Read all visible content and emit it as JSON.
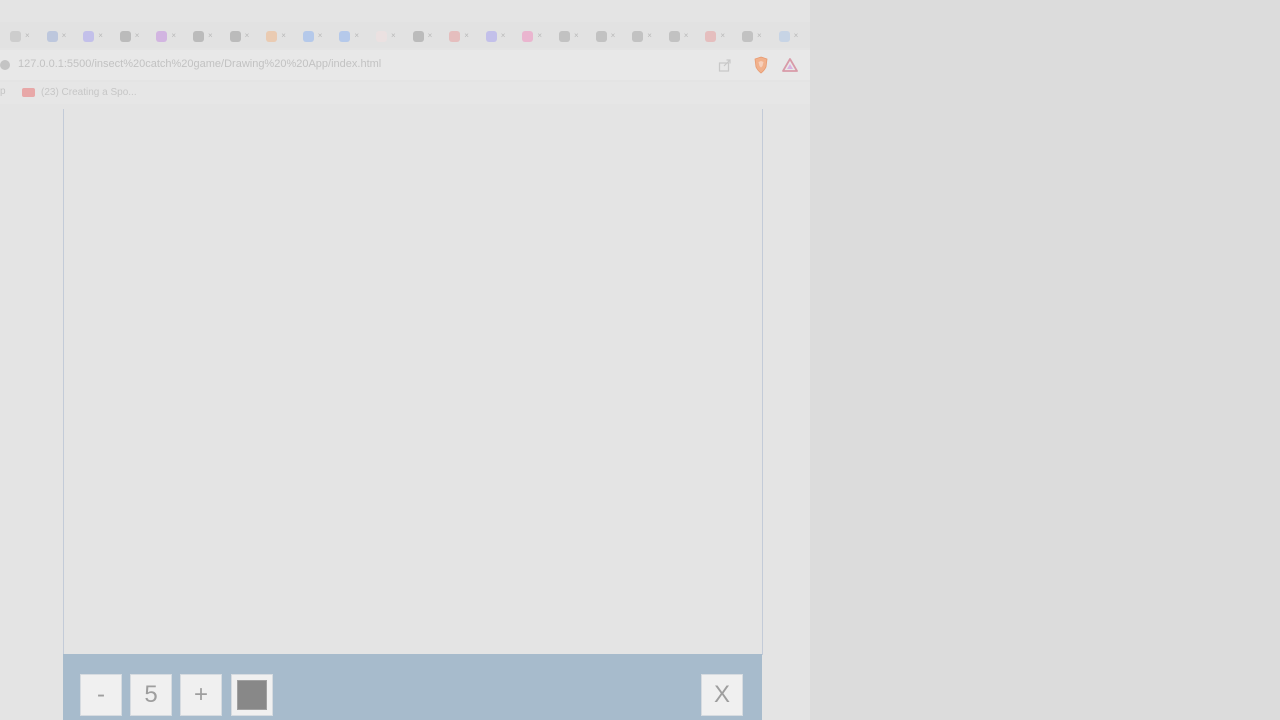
{
  "browser": {
    "address_bar": {
      "url": "127.0.0.1:5500/insect%20catch%20game/Drawing%20%20App/index.html"
    },
    "bookmarks": {
      "apps_label": "p",
      "items": [
        {
          "label": "(23) Creating a Spo...",
          "icon": "youtube-icon"
        }
      ]
    },
    "tab_icons": [
      "settings-icon",
      "home-icon",
      "bookmark-icon",
      "github-icon",
      "purple-icon",
      "github-icon",
      "github-icon",
      "orange-icon",
      "google-icon",
      "google-icon",
      "doc-icon",
      "github-icon",
      "gmail-icon",
      "bookmark-icon",
      "pink-icon",
      "window-icon",
      "window-icon",
      "window-icon",
      "window-icon",
      "gmail-icon",
      "window-icon",
      "generic-icon"
    ]
  },
  "app": {
    "toolbox": {
      "decrease_label": "-",
      "size_value": "5",
      "increase_label": "+",
      "clear_label": "X",
      "color": "#888888"
    }
  },
  "colors": {
    "page_background": "#dcdcdc",
    "browser_background": "#e4e4e4",
    "toolbox_background": "#a7bbcc",
    "canvas_border": "#c3cbd8"
  }
}
